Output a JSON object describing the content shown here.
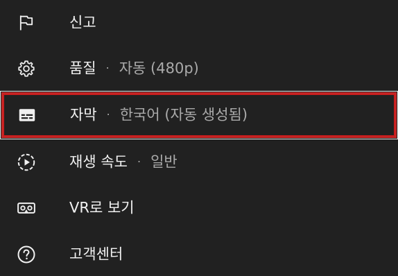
{
  "menu": {
    "items": [
      {
        "label": "신고",
        "separator": "",
        "value": "",
        "icon": "flag-icon"
      },
      {
        "label": "품질",
        "separator": "·",
        "value": "자동 (480p)",
        "icon": "gear-icon"
      },
      {
        "label": "자막",
        "separator": "·",
        "value": "한국어 (자동 생성됨)",
        "icon": "captions-icon"
      },
      {
        "label": "재생 속도",
        "separator": "·",
        "value": "일반",
        "icon": "playback-speed-icon"
      },
      {
        "label": "VR로 보기",
        "separator": "",
        "value": "",
        "icon": "vr-headset-icon"
      },
      {
        "label": "고객센터",
        "separator": "",
        "value": "",
        "icon": "help-icon"
      }
    ],
    "selected_index": 2
  },
  "colors": {
    "background": "#212121",
    "text_primary": "#f1f1f1",
    "text_secondary": "#aaaaaa",
    "highlight": "#c81e1e"
  }
}
